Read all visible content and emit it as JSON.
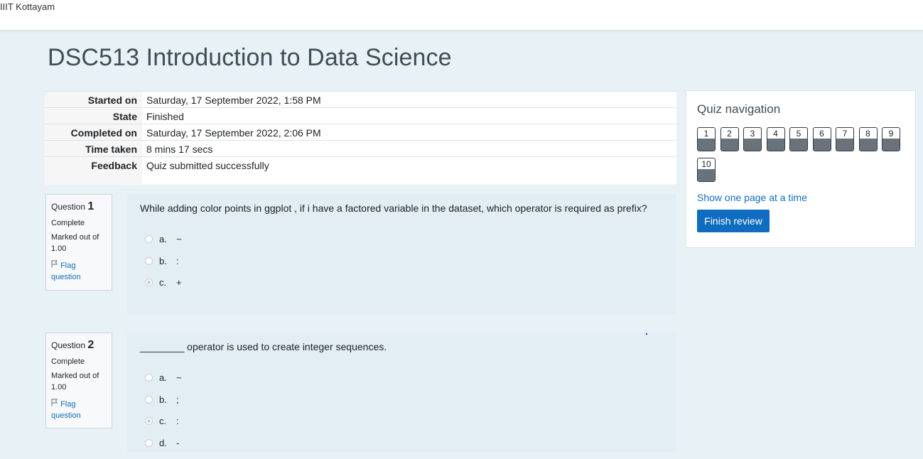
{
  "site": {
    "name": "IIIT Kottayam"
  },
  "course": {
    "title": "DSC513 Introduction to Data Science"
  },
  "summary": [
    {
      "label": "Started on",
      "value": "Saturday, 17 September 2022, 1:58 PM"
    },
    {
      "label": "State",
      "value": "Finished"
    },
    {
      "label": "Completed on",
      "value": "Saturday, 17 September 2022, 2:06 PM"
    },
    {
      "label": "Time taken",
      "value": "8 mins 17 secs"
    },
    {
      "label": "Feedback",
      "value": "Quiz submitted successfully"
    }
  ],
  "questions": [
    {
      "prefix": "Question",
      "number": "1",
      "status": "Complete",
      "marked_out_of": "Marked out of 1.00",
      "flag_label": "Flag question",
      "text": "While adding color  points in ggplot , if i have a factored variable in the dataset, which operator is required as prefix?",
      "answers": [
        {
          "letter": "a.",
          "text": "~",
          "selected": false
        },
        {
          "letter": "b.",
          "text": ":",
          "selected": false
        },
        {
          "letter": "c.",
          "text": "+",
          "selected": true
        }
      ]
    },
    {
      "prefix": "Question",
      "number": "2",
      "status": "Complete",
      "marked_out_of": "Marked out of 1.00",
      "flag_label": "Flag question",
      "text": "________ operator is used to create integer sequences.",
      "answers": [
        {
          "letter": "a.",
          "text": "~",
          "selected": false
        },
        {
          "letter": "b.",
          "text": ";",
          "selected": false
        },
        {
          "letter": "c.",
          "text": ":",
          "selected": true
        },
        {
          "letter": "d.",
          "text": "-",
          "selected": false
        }
      ]
    }
  ],
  "quiz_nav": {
    "title": "Quiz navigation",
    "buttons": [
      "1",
      "2",
      "3",
      "4",
      "5",
      "6",
      "7",
      "8",
      "9",
      "10"
    ],
    "show_one_page": "Show one page at a time",
    "finish_review": "Finish review"
  }
}
